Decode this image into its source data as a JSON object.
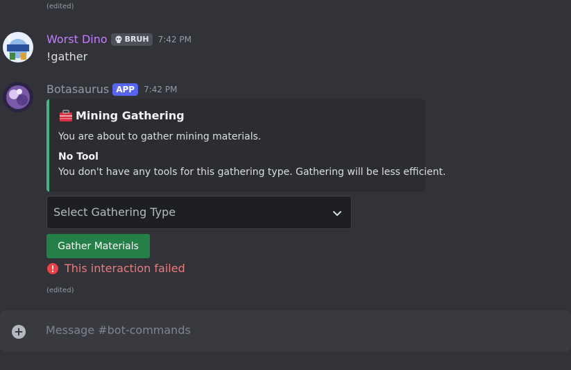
{
  "top_edited": "(edited)",
  "messages": [
    {
      "username": "Worst Dino",
      "tag_label": "BRUH",
      "time": "7:42 PM",
      "content": "!gather"
    },
    {
      "username": "Botasaurus",
      "tag_label": "APP",
      "time": "7:42 PM",
      "embed": {
        "title": "Mining Gathering",
        "description": "You are about to gather mining materials.",
        "field_name": "No Tool",
        "field_value": "You don't have any tools for this gathering type. Gathering will be less efficient."
      },
      "select_placeholder": "Select Gathering Type",
      "button_label": "Gather Materials",
      "error_text": "This interaction failed",
      "edited": "(edited)"
    }
  ],
  "composer": {
    "placeholder": "Message #bot-commands"
  },
  "colors": {
    "user1_name": "#c77dff",
    "bot_name": "#949ba4",
    "embed_accent": "#43b581",
    "button": "#248046",
    "error": "#f0797b",
    "app_tag": "#5865f2"
  }
}
